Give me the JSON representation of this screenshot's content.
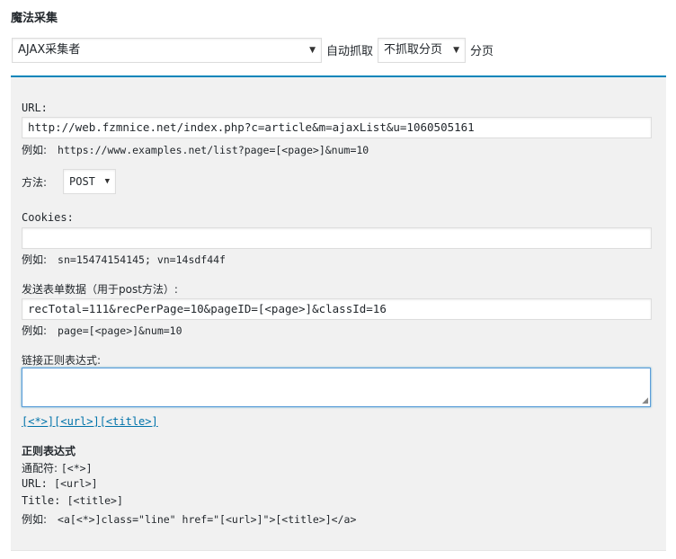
{
  "header": {
    "title": "魔法采集"
  },
  "controls": {
    "collector": "AJAX采集者",
    "auto_fetch_label": "自动抓取",
    "paging_value": "不抓取分页",
    "paging_label": "分页"
  },
  "form": {
    "url_label": "URL:",
    "url_value": "http://web.fzmnice.net/index.php?c=article&m=ajaxList&u=1060505161",
    "url_example_prefix": "例如:",
    "url_example": "https://www.examples.net/list?page=[<page>]&num=10",
    "method_label": "方法:",
    "method_value": "POST",
    "cookies_label": "Cookies:",
    "cookies_value": "",
    "cookies_example_prefix": "例如:",
    "cookies_example": "sn=15474154145; vn=14sdf44f",
    "postdata_label": "发送表单数据（用于post方法）:",
    "postdata_value": "recTotal=111&recPerPage=10&pageID=[<page>]&classId=16",
    "postdata_example_prefix": "例如:",
    "postdata_example": "page=[<page>]&num=10",
    "regex_label": "链接正则表达式:",
    "regex_value": "",
    "tag_any": "[<*>]",
    "tag_url": "[<url>]",
    "tag_title": "[<title>]"
  },
  "help": {
    "title": "正则表达式",
    "wildcard_prefix": "通配符:",
    "wildcard_code": "[<*>]",
    "url_prefix": "URL:",
    "url_code": "[<url>]",
    "title_prefix": "Title:",
    "title_code": "[<title>]",
    "example_prefix": "例如:",
    "example_code": "<a[<*>]class=\"line\" href=\"[<url>]\">[<title>]</a>"
  },
  "icons": {
    "caret": "caret-down-icon",
    "resize": "resize-grip-icon"
  },
  "colors": {
    "accent": "#0085ba",
    "link": "#0073aa",
    "panel_bg": "#f1f1f1",
    "focus_border": "#5b9dd9"
  }
}
